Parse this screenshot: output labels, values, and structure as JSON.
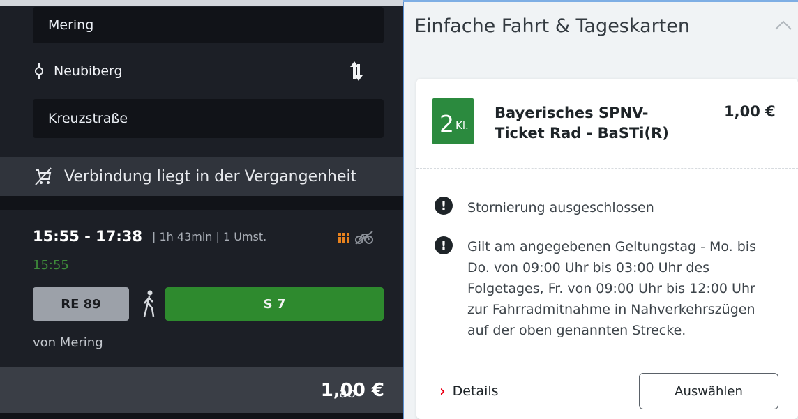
{
  "search_form": {
    "origin": "Mering",
    "via": "Neubiberg",
    "destination": "Kreuzstraße"
  },
  "notice": {
    "text": "Verbindung liegt in der Vergangenheit",
    "icon": "cart-crossed-icon"
  },
  "connection": {
    "time_range": "15:55 - 17:38",
    "details": "| 1h 43min | 1 Umst.",
    "actual_departure": "15:55",
    "trains": [
      {
        "label": "RE 89",
        "color": "#9ca1a9"
      },
      {
        "label": "S 7",
        "color": "#2e8a2e"
      }
    ],
    "from_station": "von Mering",
    "price_prefix": "ab",
    "price": "1,00 €"
  },
  "offer_panel": {
    "section_title": "Einfache Fahrt & Tageskarten",
    "class_number": "2",
    "class_label": "Kl.",
    "ticket_name": "Bayerisches SPNV-Ticket Rad - BaSTi(R)",
    "ticket_price": "1,00 €",
    "notes": [
      "Stornierung ausgeschlossen",
      "Gilt am angegebenen Geltungstag - Mo. bis Do. von 09:00 Uhr bis 03:00 Uhr des Folgetages, Fr. von 09:00 Uhr bis 12:00 Uhr zur Fahrradmitnahme in Nahverkehrszügen auf der oben genannten Strecke."
    ],
    "note_icon_glyph": "!",
    "details_link": "Details",
    "select_button": "Auswählen"
  },
  "colors": {
    "accent_red": "#ec0016",
    "class_badge_green": "#2b8a3e",
    "occupancy_orange": "#e8821e"
  }
}
